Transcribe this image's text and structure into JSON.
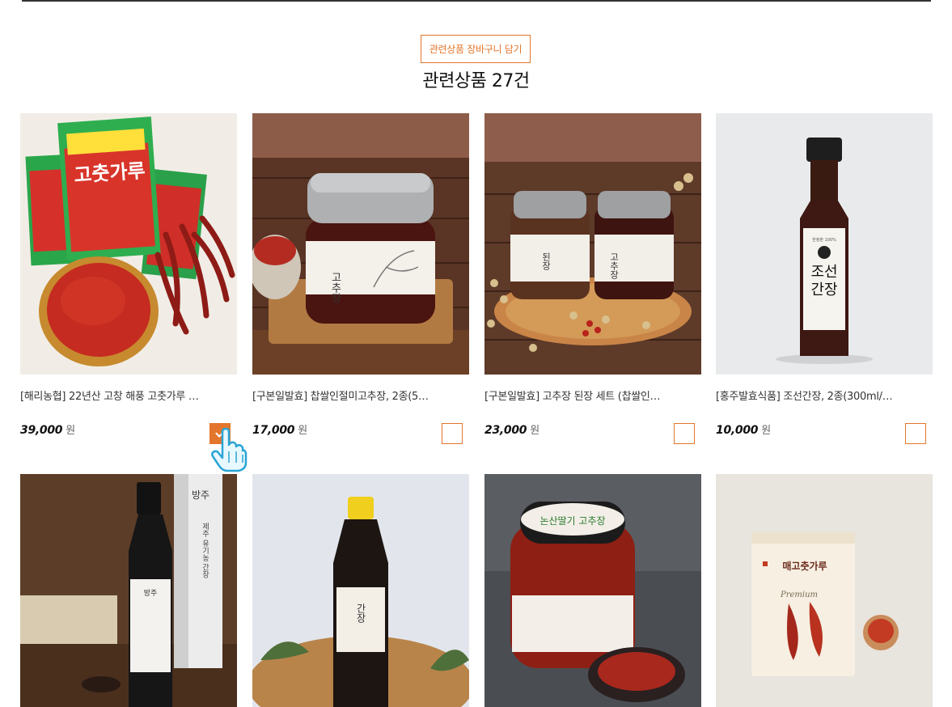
{
  "header": {
    "cart_button_label": "관련상품 장바구니 담기",
    "section_title": "관련상품 27건"
  },
  "products": [
    {
      "name": "[해리농협] 22년산 고창 해풍 고춧가루 …",
      "price": "39,000",
      "unit": "원",
      "checked": true,
      "image": "chili-powder-bags"
    },
    {
      "name": "[구본일발효] 찹쌀인절미고추장, 2종(5…",
      "price": "17,000",
      "unit": "원",
      "checked": false,
      "image": "gochujang-jar"
    },
    {
      "name": "[구본일발효] 고추장 된장 세트 (찹쌀인…",
      "price": "23,000",
      "unit": "원",
      "checked": false,
      "image": "gochujang-doenjang-jars"
    },
    {
      "name": "[홍주발효식품] 조선간장, 2종(300ml/…",
      "price": "10,000",
      "unit": "원",
      "checked": false,
      "image": "soy-sauce-bottle"
    },
    {
      "name": "",
      "price": "",
      "unit": "",
      "checked": false,
      "image": "jeju-soy-sauce-bottle-box"
    },
    {
      "name": "",
      "price": "",
      "unit": "",
      "checked": false,
      "image": "soy-sauce-pet-bottle"
    },
    {
      "name": "",
      "price": "",
      "unit": "",
      "checked": false,
      "image": "gochujang-large-jar"
    },
    {
      "name": "",
      "price": "",
      "unit": "",
      "checked": false,
      "image": "red-pepper-powder-pouch"
    }
  ],
  "image_text": {
    "bag_label": "고춧가루",
    "jar_label": "고추장",
    "jar_label_2": "된장",
    "bottle_label": "조선\n간장",
    "bottle_top": "한정판 100%",
    "jeju_brand": "방주",
    "jeju_box": "제주 유기농 간장",
    "pet_label": "간장",
    "big_jar_top": "논산딸기 고추장",
    "pouch_title": "매고춧가루",
    "pouch_sub": "Premium"
  },
  "colors": {
    "accent": "#e3762c"
  }
}
